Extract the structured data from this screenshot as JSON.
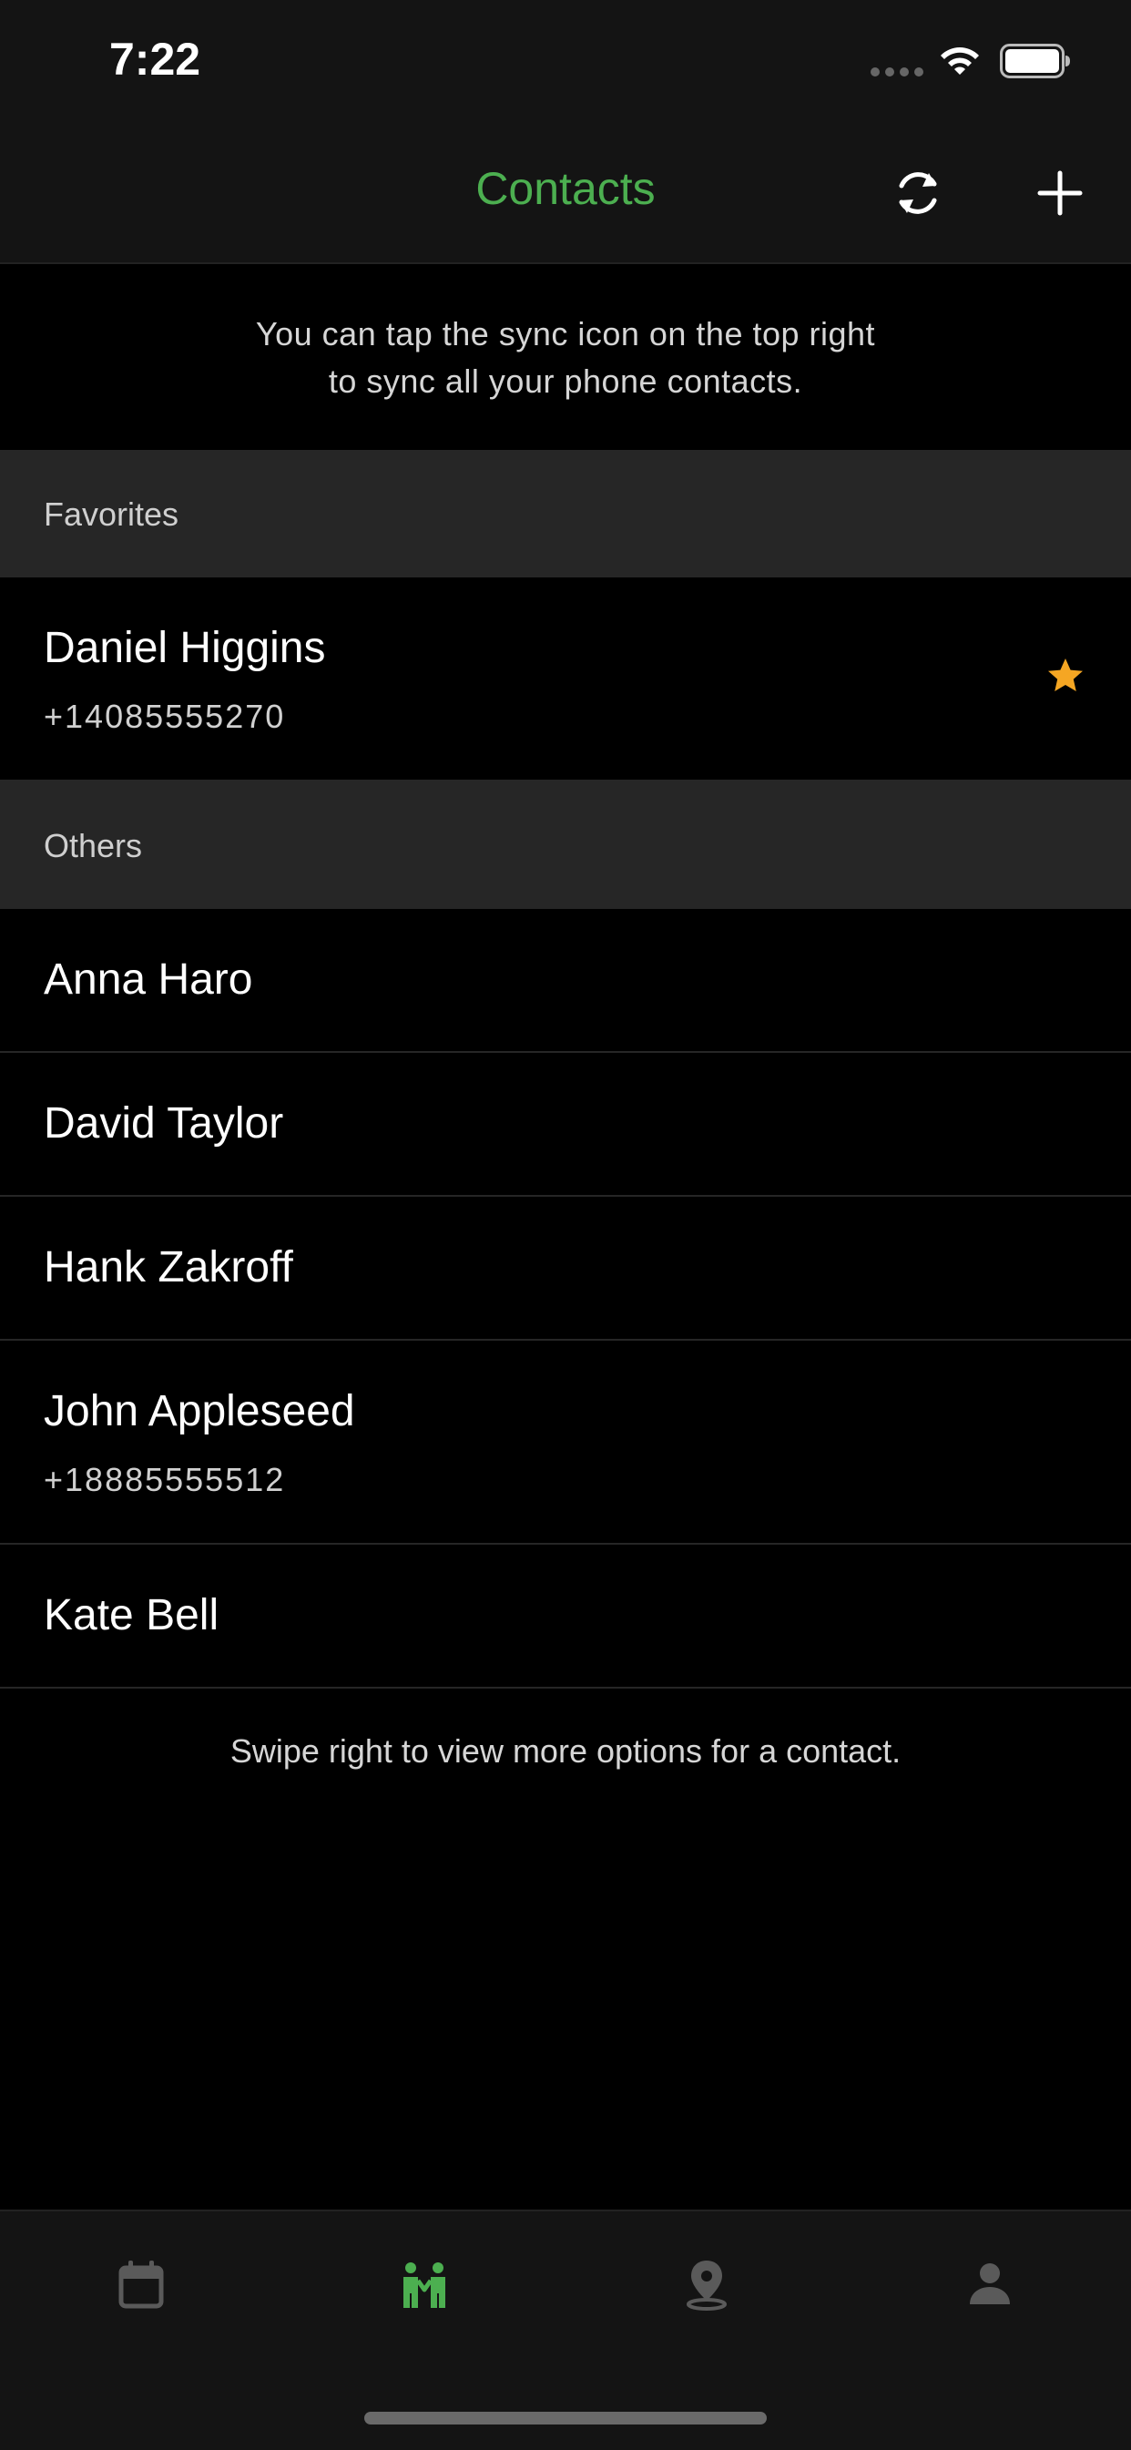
{
  "status_bar": {
    "time": "7:22",
    "icons": [
      "signal-dots",
      "wifi-icon",
      "battery-icon"
    ]
  },
  "nav": {
    "title": "Contacts",
    "title_color": "#4caf50",
    "sync_icon": "sync-icon",
    "add_icon": "plus-icon"
  },
  "hint": {
    "line1": "You can tap the sync icon on the top right",
    "line2": "to sync all your phone contacts."
  },
  "sections": {
    "favorites": {
      "label": "Favorites",
      "contacts": [
        {
          "name": "Daniel Higgins",
          "phone": "+14085555270",
          "starred": true,
          "star_color": "#f5a623"
        }
      ]
    },
    "others": {
      "label": "Others",
      "contacts": [
        {
          "name": "Anna Haro"
        },
        {
          "name": "David Taylor"
        },
        {
          "name": "Hank Zakroff"
        },
        {
          "name": "John Appleseed",
          "phone": "+18885555512"
        },
        {
          "name": "Kate Bell"
        }
      ]
    }
  },
  "footer_hint": "Swipe right to view more options for a contact.",
  "tab_bar": {
    "tabs": [
      {
        "icon": "calendar-icon",
        "active": false
      },
      {
        "icon": "people-icon",
        "active": true
      },
      {
        "icon": "location-pin-icon",
        "active": false
      },
      {
        "icon": "person-icon",
        "active": false
      }
    ],
    "active_color": "#4caf50",
    "inactive_color": "#5a5a5a"
  }
}
